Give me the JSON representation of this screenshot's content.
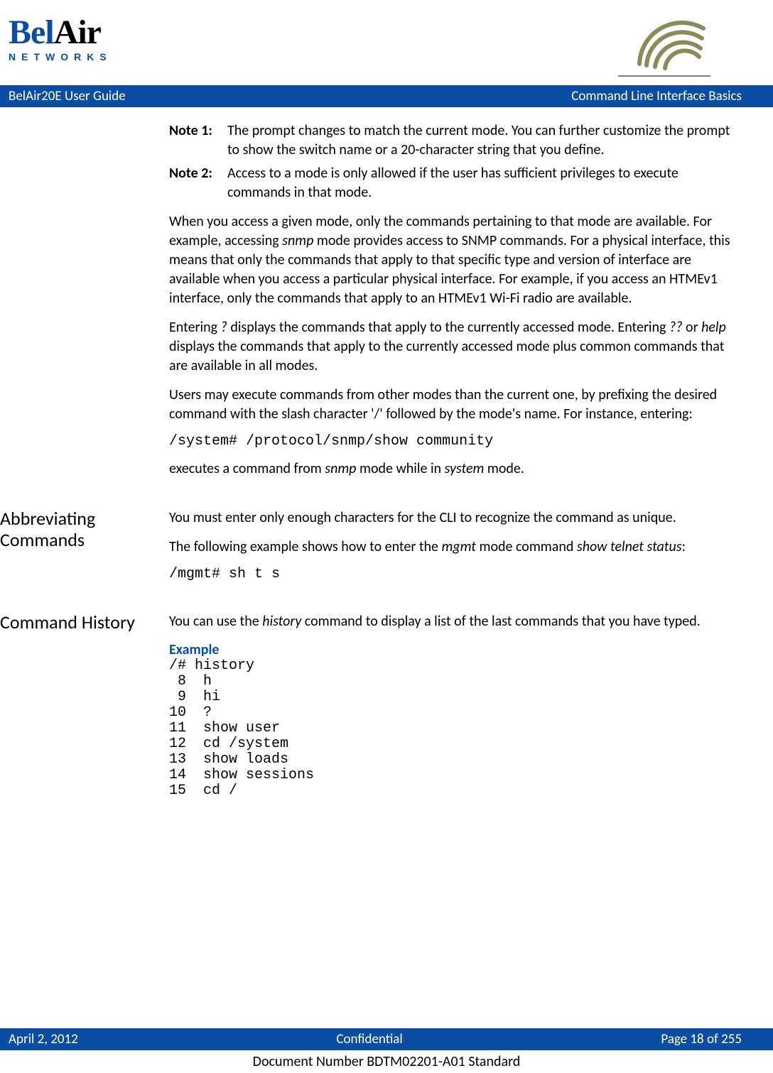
{
  "header": {
    "logo_bel": "Bel",
    "logo_air": "Air",
    "logo_networks": "NETWORKS"
  },
  "banner": {
    "left": "BelAir20E User Guide",
    "right": "Command Line Interface Basics"
  },
  "notes": {
    "n1_label": "Note 1:",
    "n1_body": "The prompt changes to match the current mode. You can further customize the prompt to show the switch name or a 20-character string that you define.",
    "n2_label": "Note 2:",
    "n2_body": "Access to a mode is only allowed if the user has sufficient privileges to execute commands in that mode."
  },
  "body": {
    "p1a": "When you access a given mode, only the commands pertaining to that mode are available. For example, accessing ",
    "p1_snmp": "snmp",
    "p1b": " mode provides access to SNMP commands. For a physical interface, this means that only the commands that apply to that specific type and version of interface are available when you access a particular physical interface. For example, if you access an HTMEv1 interface, only the commands that apply to an HTMEv1 Wi-Fi radio are available.",
    "p2a": "Entering ",
    "p2_q": "?",
    "p2b": " displays the commands that apply to the currently accessed mode. Entering ",
    "p2_qq": "??",
    "p2c": " or ",
    "p2_help": "help",
    "p2d": " displays the commands that apply to the currently accessed mode plus common commands that are available in all modes.",
    "p3": "Users may execute commands from other modes than the current one, by prefixing the desired command with the slash character '/' followed by the mode's name. For instance, entering:",
    "code1": "/system# /protocol/snmp/show community",
    "p4a": "executes a command from ",
    "p4_snmp": "snmp",
    "p4b": " mode while in ",
    "p4_system": "system",
    "p4c": " mode."
  },
  "abbrev": {
    "heading": "Abbreviating Commands",
    "p1": "You must enter only enough characters for the CLI to recognize the command as unique.",
    "p2a": "The following example shows how to enter the ",
    "p2_mgmt": "mgmt",
    "p2b": " mode command ",
    "p2_cmd": "show telnet status",
    "p2c": ":",
    "code": "/mgmt# sh t s"
  },
  "history": {
    "heading": "Command History",
    "p1a": "You can use the ",
    "p1_history": "history",
    "p1b": " command to display a list of the last commands that you have typed.",
    "example_label": "Example",
    "code": "/# history\n 8  h\n 9  hi\n10  ?\n11  show user\n12  cd /system\n13  show loads\n14  show sessions\n15  cd /"
  },
  "footer": {
    "left": "April 2, 2012",
    "center": "Confidential",
    "right": "Page 18 of 255",
    "docnum": "Document Number BDTM02201-A01 Standard"
  }
}
